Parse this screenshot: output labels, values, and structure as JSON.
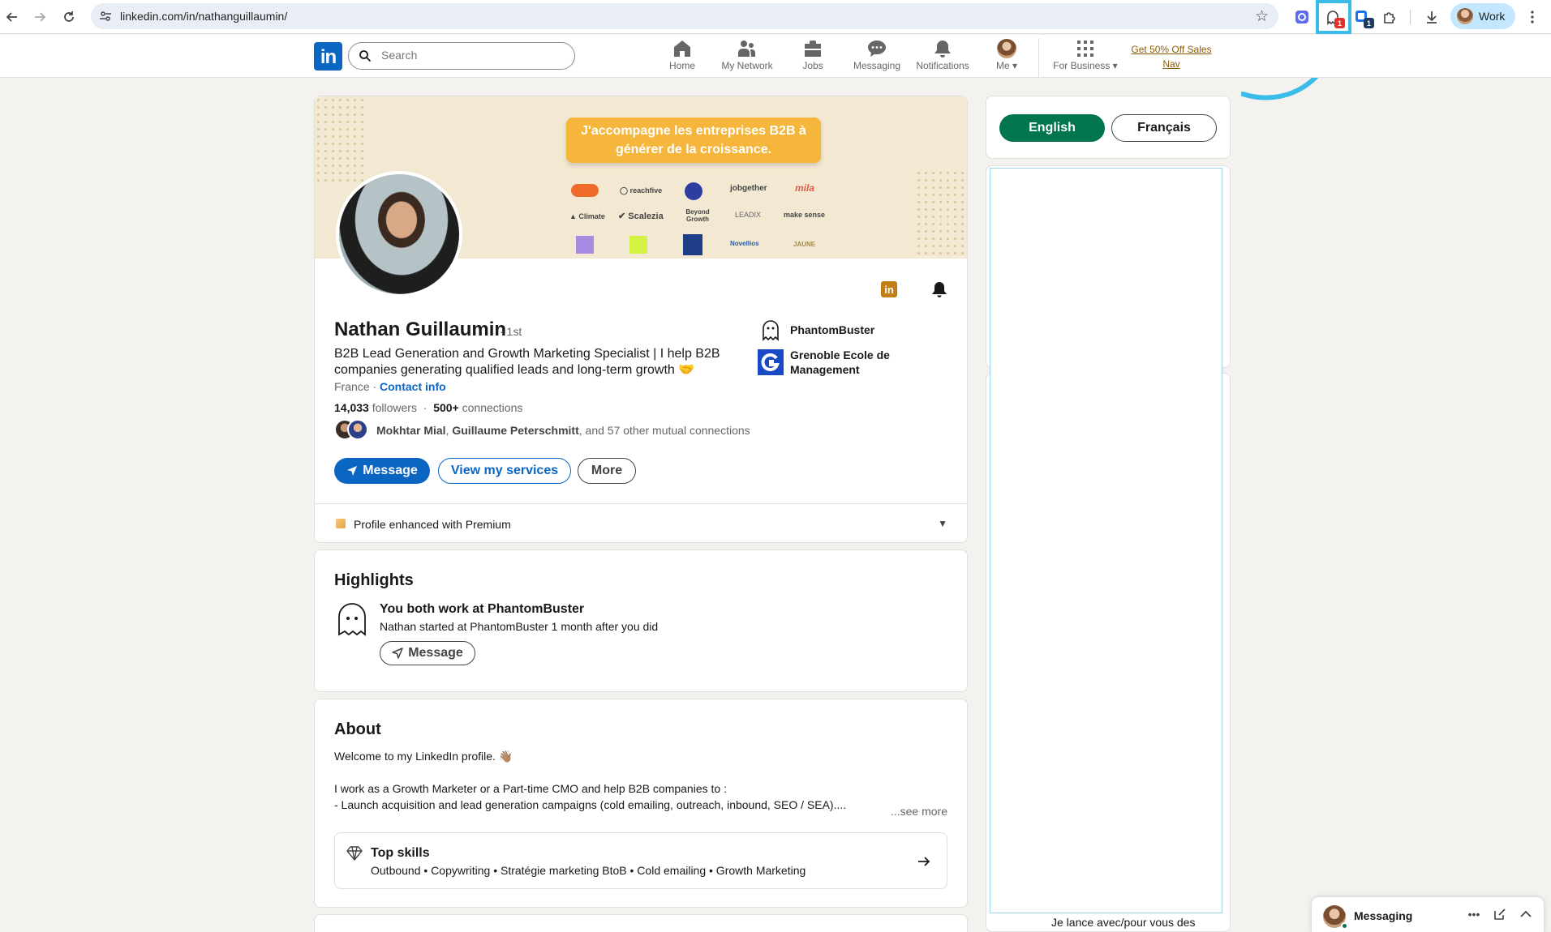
{
  "browser": {
    "url": "linkedin.com/in/nathanguillaumin/",
    "profile_label": "Work",
    "ext_badge_1": "1",
    "ext_badge_2": "1"
  },
  "linkedin_nav": {
    "search_placeholder": "Search",
    "items": [
      {
        "label": "Home",
        "icon": "home-icon"
      },
      {
        "label": "My Network",
        "icon": "network-icon"
      },
      {
        "label": "Jobs",
        "icon": "briefcase-icon"
      },
      {
        "label": "Messaging",
        "icon": "chat-icon"
      },
      {
        "label": "Notifications",
        "icon": "bell-icon"
      },
      {
        "label": "Me",
        "icon": "avatar"
      },
      {
        "label": "For Business",
        "icon": "grid-icon"
      }
    ],
    "promo_line1": "Get 50% Off Sales",
    "promo_line2": "Nav"
  },
  "banner": {
    "tagline_line1": "J'accompagne les entreprises B2B à",
    "tagline_line2": "générer de la croissance.",
    "logos": [
      "reachfive",
      "jobgether",
      "Climate",
      "Scalezia",
      "Beyond Growth",
      "LEADIX",
      "make sense",
      "Novellios",
      "JAUNE"
    ]
  },
  "profile": {
    "name": "Nathan Guillaumin",
    "degree": "· 1st",
    "headline": "B2B Lead Generation and Growth Marketing Specialist | I help B2B companies generating qualified leads and long-term growth 🤝",
    "location": "France · ",
    "contact_info": "Contact info",
    "followers_count": "14,033",
    "followers_label": " followers",
    "connections_count": "500+",
    "connections_label": " connections",
    "mutual_name_1": "Mokhtar Mial",
    "mutual_sep": ", ",
    "mutual_name_2": "Guillaume Peterschmitt",
    "mutual_rest": ", and 57 other mutual connections",
    "buttons": {
      "message": "Message",
      "services": "View my services",
      "more": "More"
    },
    "premium_text": "Profile enhanced with Premium",
    "orgs": [
      {
        "name": "PhantomBuster"
      },
      {
        "name_line1": "Grenoble Ecole de",
        "name_line2": "Management"
      }
    ]
  },
  "highlights": {
    "title": "Highlights",
    "heading": "You both work at PhantomBuster",
    "detail": "Nathan started at PhantomBuster 1 month after you did",
    "button": "Message"
  },
  "about": {
    "title": "About",
    "line1": "Welcome to my LinkedIn profile. 👋🏽",
    "line2": "I work as a Growth Marketer or a Part-time CMO and help B2B companies to :",
    "line3": "- Launch acquisition and lead generation campaigns (cold emailing, outreach, inbound, SEO / SEA)....",
    "see_more": "...see more",
    "skills_title": "Top skills",
    "skills_list": "Outbound • Copywriting • Stratégie marketing BtoB • Cold emailing • Growth Marketing"
  },
  "right_rail": {
    "lang_active": "English",
    "lang_other": "Français",
    "bottom_text": "Je lance avec/pour vous des"
  },
  "messaging_dock": {
    "label": "Messaging"
  },
  "colors": {
    "linkedin_blue": "#0a66c2",
    "active_lang_green": "#01754f",
    "highlight_cyan": "#3bbbe7",
    "premium_gold": "#915907"
  }
}
